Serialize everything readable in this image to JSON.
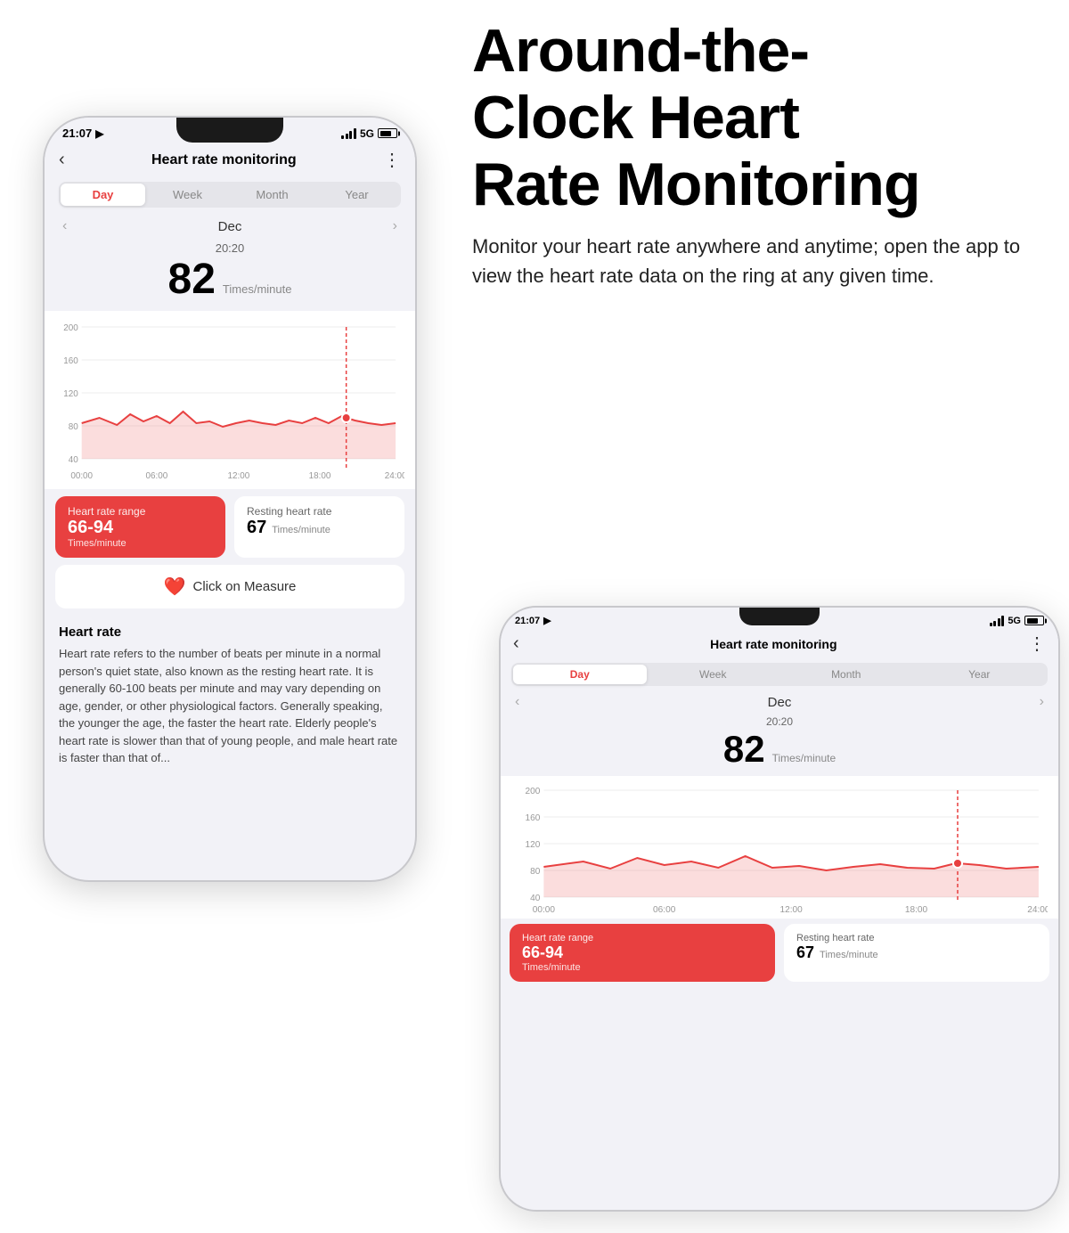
{
  "headline": {
    "line1": "Around-the-",
    "line2": "Clock Heart",
    "line3": "Rate Monitoring"
  },
  "subtext": "Monitor your heart rate anywhere and anytime; open the app to view the heart rate data on the ring at any given time.",
  "phone_left": {
    "status": {
      "time": "21:07",
      "signal": "5G"
    },
    "nav": {
      "back": "‹",
      "title": "Heart rate monitoring",
      "more": "⋮"
    },
    "segments": [
      "Day",
      "Week",
      "Month",
      "Year"
    ],
    "active_segment": "Day",
    "date_nav": {
      "prev": "‹",
      "month": "Dec",
      "next": "›"
    },
    "hr_time": "20:20",
    "hr_value": "82",
    "hr_unit": "Times/minute",
    "chart": {
      "y_labels": [
        "200",
        "160",
        "120",
        "80",
        "40"
      ],
      "x_labels": [
        "00:00",
        "06:00",
        "12:00",
        "18:00",
        "24:00"
      ]
    },
    "stats": {
      "range_label": "Heart rate range",
      "range_value": "66-94",
      "range_unit": "Times/minute",
      "resting_label": "Resting heart rate",
      "resting_value": "67",
      "resting_unit": "Times/minute"
    },
    "measure_btn": "Click on Measure",
    "info_title": "Heart rate",
    "info_text": "Heart rate refers to the number of beats per minute in a normal person's quiet state, also known as the resting heart rate. It is generally 60-100 beats per minute and may vary depending on age, gender, or other physiological factors. Generally speaking, the younger the age, the faster the heart rate. Elderly people's heart rate is slower than that of young people, and male heart rate is faster than that of..."
  },
  "phone_right": {
    "status": {
      "time": "21:07",
      "signal": "5G"
    },
    "nav": {
      "back": "‹",
      "title": "Heart rate monitoring",
      "more": "⋮"
    },
    "segments": [
      "Day",
      "Week",
      "Month",
      "Year"
    ],
    "active_segment": "Day",
    "date_nav": {
      "prev": "‹",
      "month": "Dec",
      "next": "›"
    },
    "hr_time": "20:20",
    "hr_value": "82",
    "hr_unit": "Times/minute",
    "chart": {
      "y_labels": [
        "200",
        "160",
        "120",
        "80",
        "40"
      ],
      "x_labels": [
        "00:00",
        "06:00",
        "12:00",
        "18:00",
        "24:00"
      ]
    },
    "stats": {
      "range_label": "Heart rate range",
      "range_value": "66-94",
      "range_unit": "Times/minute",
      "resting_label": "Resting heart rate",
      "resting_value": "67",
      "resting_unit": "Times/minute"
    }
  }
}
